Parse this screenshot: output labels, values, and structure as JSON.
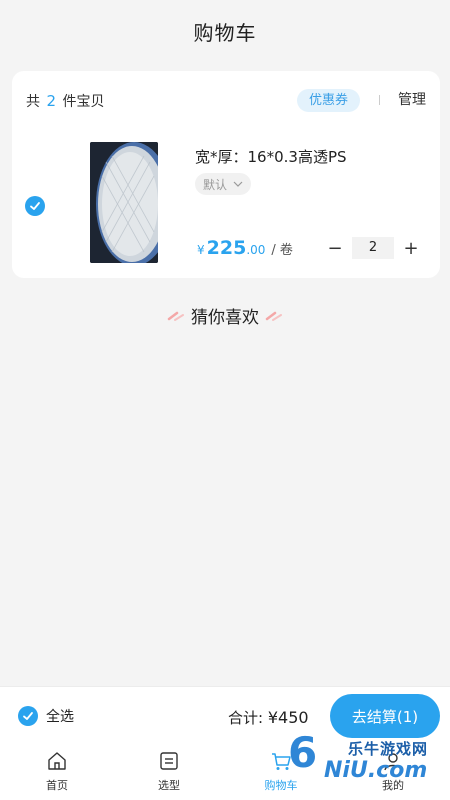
{
  "header": {
    "title": "购物车"
  },
  "cart": {
    "count_prefix": "共",
    "count": "2",
    "count_suffix": "件宝贝",
    "coupon_label": "优惠券",
    "manage_label": "管理",
    "item": {
      "selected": true,
      "name": "宽*厚：16*0.3高透PS",
      "spec": "默认",
      "currency": "¥",
      "price_int": "225",
      "price_dec": ".00",
      "unit": "/ 卷",
      "quantity": "2",
      "minus": "−",
      "plus": "+"
    }
  },
  "guess": {
    "title": "猜你喜欢"
  },
  "bottom": {
    "select_all": "全选",
    "total_label": "合计:",
    "total_amount": "¥450",
    "checkout_label": "去结算(1)"
  },
  "tabs": [
    {
      "label": "首页",
      "icon": "home-icon"
    },
    {
      "label": "选型",
      "icon": "list-icon"
    },
    {
      "label": "购物车",
      "icon": "cart-icon",
      "active": true
    },
    {
      "label": "我的",
      "icon": "user-icon"
    }
  ],
  "watermark": {
    "text": "乐牛游戏网",
    "logo": "6",
    "sub": "NiU.com"
  },
  "colors": {
    "accent": "#2aa3ee",
    "background": "#f4f4f4"
  }
}
